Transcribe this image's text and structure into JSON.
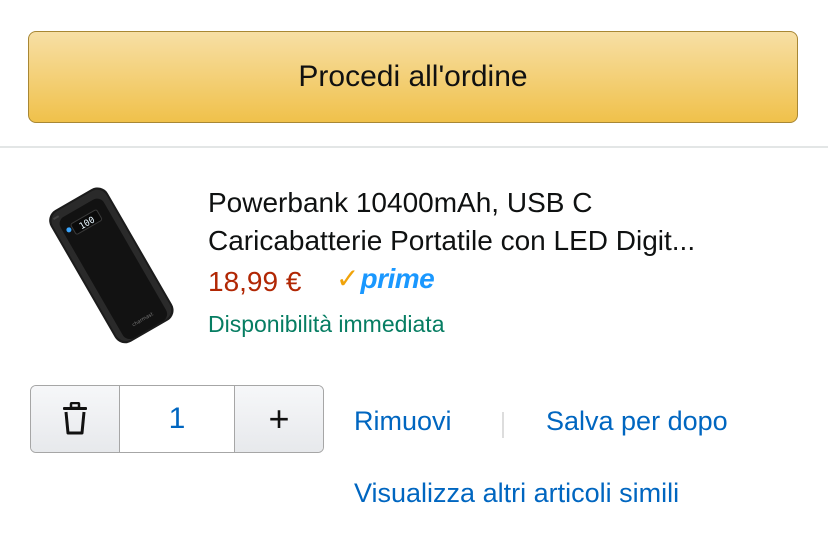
{
  "checkout": {
    "label": "Procedi all'ordine"
  },
  "item": {
    "title_line1": "Powerbank 10400mAh, USB C",
    "title_line2": "Caricabatterie Portatile con LED Digit...",
    "price": "18,99 €",
    "prime": "prime",
    "availability": "Disponibilità immediata",
    "quantity": "1",
    "image_alt": "power-bank-photo"
  },
  "actions": {
    "remove": "Rimuovi",
    "save_for_later": "Salva per dopo",
    "see_similar": "Visualizza altri articoli simili"
  },
  "icons": {
    "delete": "trash-icon",
    "increase": "plus-icon",
    "prime_check": "check-icon"
  },
  "colors": {
    "price": "#b12704",
    "link": "#0066c0",
    "availability": "#067d62",
    "button": "#f0c14b",
    "prime": "#1a98ff"
  }
}
